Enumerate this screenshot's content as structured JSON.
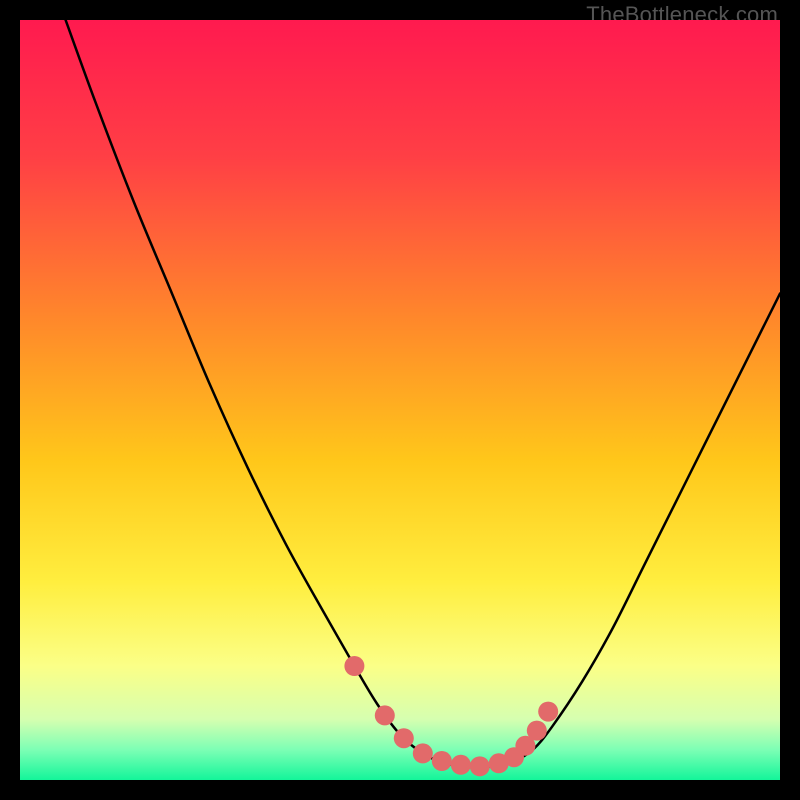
{
  "watermark": "TheBottleneck.com",
  "chart_data": {
    "type": "line",
    "title": "",
    "xlabel": "",
    "ylabel": "",
    "xlim": [
      0,
      100
    ],
    "ylim": [
      0,
      100
    ],
    "background_gradient_stops": [
      {
        "offset": 0,
        "color": "#ff1a4f"
      },
      {
        "offset": 18,
        "color": "#ff3f45"
      },
      {
        "offset": 40,
        "color": "#ff8a2a"
      },
      {
        "offset": 58,
        "color": "#ffc71a"
      },
      {
        "offset": 74,
        "color": "#ffee3f"
      },
      {
        "offset": 85,
        "color": "#fbff87"
      },
      {
        "offset": 92,
        "color": "#d6ffb0"
      },
      {
        "offset": 96,
        "color": "#7dffb5"
      },
      {
        "offset": 100,
        "color": "#13f59a"
      }
    ],
    "series": [
      {
        "name": "curve",
        "x": [
          6,
          10,
          15,
          20,
          25,
          30,
          35,
          40,
          44,
          47,
          50,
          53,
          56,
          59,
          62,
          65,
          67.5,
          70,
          74,
          78,
          82,
          86,
          90,
          94,
          98,
          100
        ],
        "y": [
          100,
          89,
          76,
          64,
          52,
          41,
          31,
          22,
          15,
          10,
          6,
          3.5,
          2.2,
          1.8,
          1.8,
          2.5,
          4,
          7,
          13,
          20,
          28,
          36,
          44,
          52,
          60,
          64
        ]
      }
    ],
    "markers": {
      "name": "points",
      "x": [
        44.0,
        48.0,
        50.5,
        53.0,
        55.5,
        58.0,
        60.5,
        63.0,
        65.0,
        66.5,
        68.0,
        69.5
      ],
      "y": [
        15.0,
        8.5,
        5.5,
        3.5,
        2.5,
        2.0,
        1.8,
        2.2,
        3.0,
        4.5,
        6.5,
        9.0
      ],
      "color": "#e26a6a",
      "radius": 10
    }
  }
}
